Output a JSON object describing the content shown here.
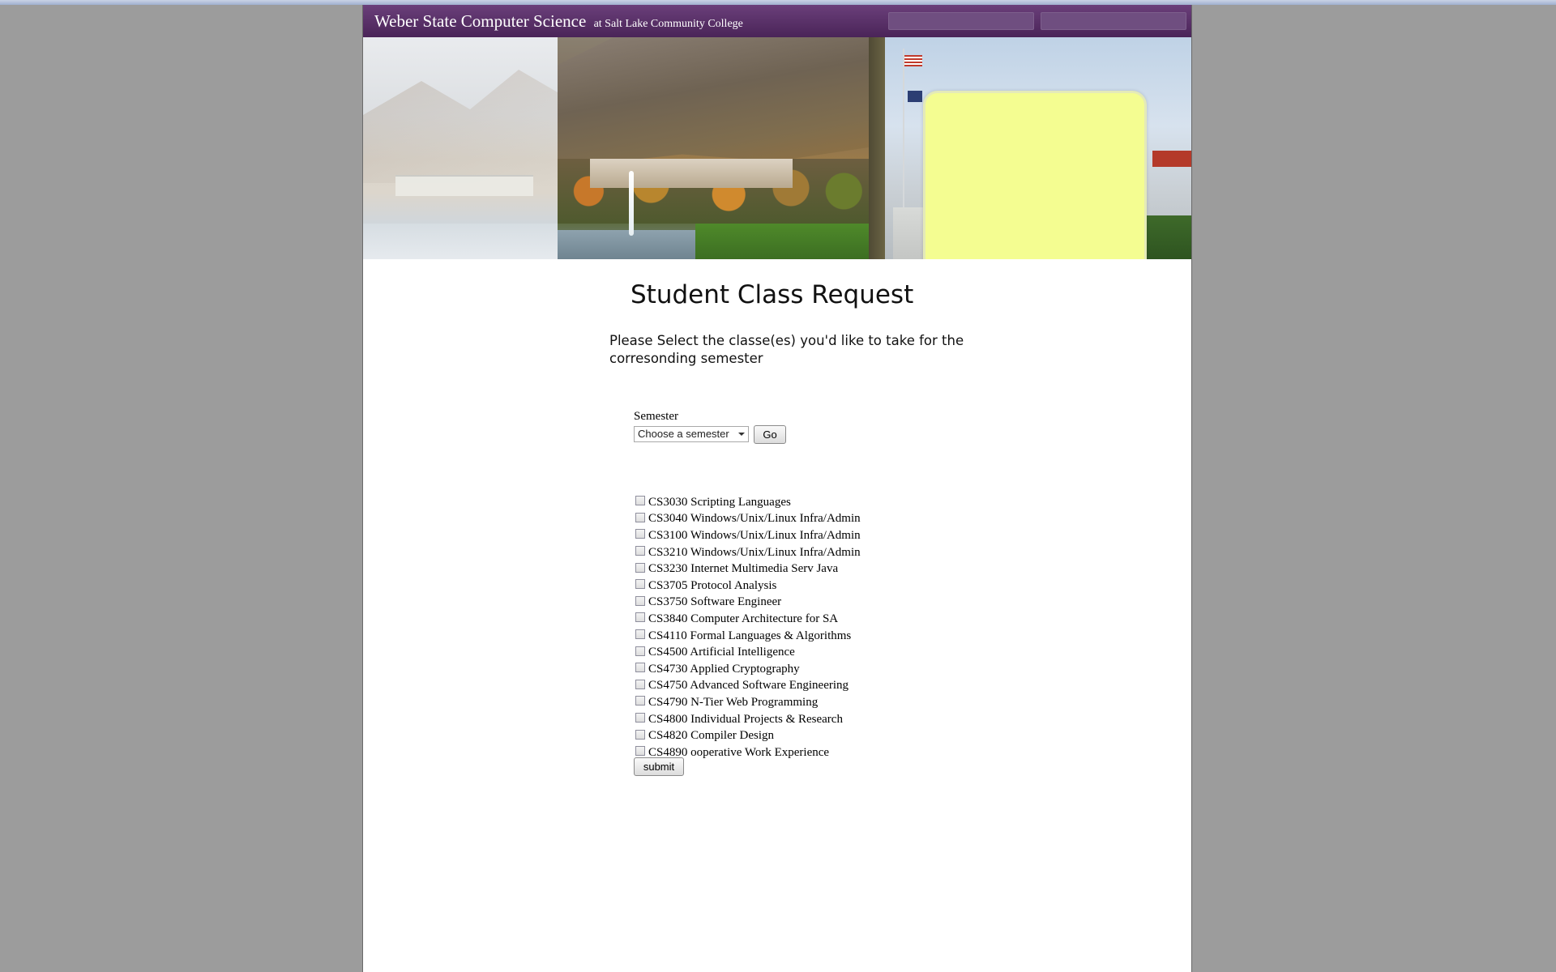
{
  "header": {
    "title": "Weber State Computer Science",
    "subtitle": "at Salt Lake Community College"
  },
  "main": {
    "heading": "Student Class Request",
    "instructions": "Please Select the classe(es) you'd like to take for the corresonding semester"
  },
  "semester": {
    "label": "Semester",
    "selected": "Choose a semester",
    "go_label": "Go"
  },
  "courses": [
    "CS3030 Scripting Languages",
    "CS3040 Windows/Unix/Linux Infra/Admin",
    "CS3100 Windows/Unix/Linux Infra/Admin",
    "CS3210 Windows/Unix/Linux Infra/Admin",
    "CS3230 Internet Multimedia Serv Java",
    "CS3705 Protocol Analysis",
    "CS3750 Software Engineer",
    "CS3840 Computer Architecture for SA",
    "CS4110 Formal Languages & Algorithms",
    "CS4500 Artificial Intelligence",
    "CS4730 Applied Cryptography",
    "CS4750 Advanced Software Engineering",
    "CS4790 N-Tier Web Programming",
    "CS4800 Individual Projects & Research",
    "CS4820 Compiler Design",
    "CS4890 ooperative Work Experience"
  ],
  "form": {
    "submit_label": "submit"
  },
  "colors": {
    "header_purple": "#4a2458",
    "info_box_yellow": "#f4fd91",
    "page_background": "#9c9c9c"
  }
}
